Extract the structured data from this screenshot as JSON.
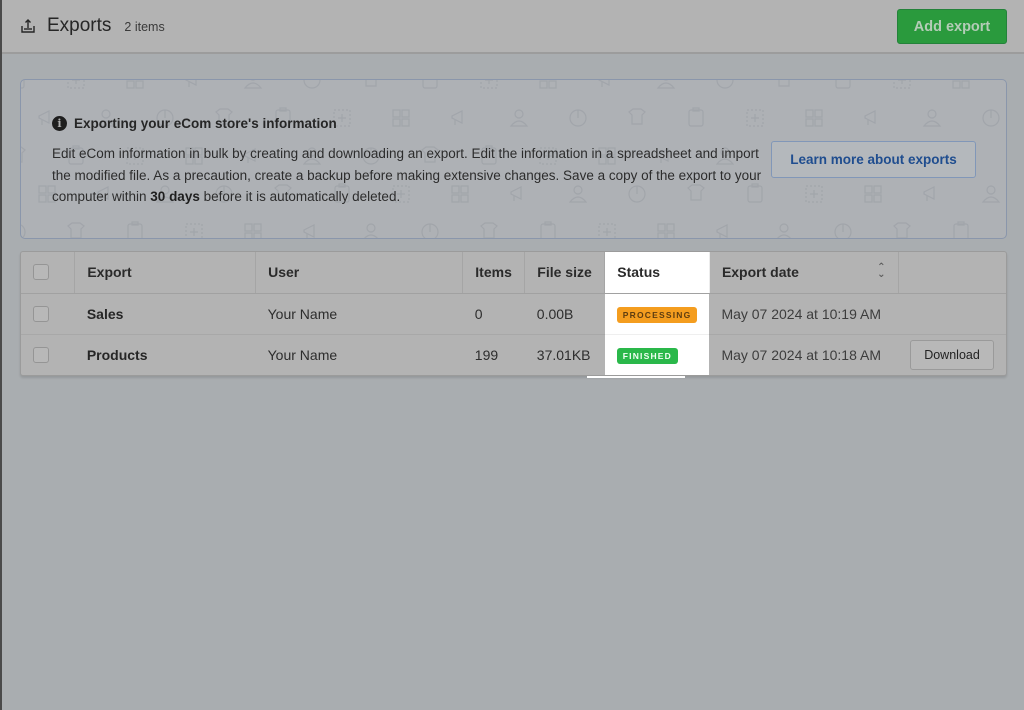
{
  "header": {
    "title": "Exports",
    "count": "2 items",
    "add_button": "Add export",
    "icon": "export-tray-icon"
  },
  "banner": {
    "title": "Exporting your eCom store's information",
    "text_before": "Edit eCom information in bulk by creating and downloading an export. Edit the information in a spreadsheet and import the modified file. As a precaution, create a backup before making extensive changes. Save a copy of the export to your computer within ",
    "text_bold": "30 days",
    "text_after": " before it is automatically deleted.",
    "learn_button": "Learn more about exports",
    "info_glyph": "i"
  },
  "table": {
    "columns": [
      "Export",
      "User",
      "Items",
      "File size",
      "Status",
      "Export date"
    ],
    "sort_glyph": "⌃⌄",
    "rows": [
      {
        "export": "Sales",
        "user": "Your Name",
        "items": "0",
        "file_size": "0.00B",
        "status": "PROCESSING",
        "export_date": "May 07 2024 at 10:19 AM",
        "action": ""
      },
      {
        "export": "Products",
        "user": "Your Name",
        "items": "199",
        "file_size": "37.01KB",
        "status": "FINISHED",
        "export_date": "May 07 2024 at 10:18 AM",
        "action": "Download"
      }
    ]
  },
  "colors": {
    "primary_green": "#2a9a3d",
    "processing": "#f49d1f",
    "finished": "#2ab84a",
    "link_blue": "#1f4d8f"
  }
}
